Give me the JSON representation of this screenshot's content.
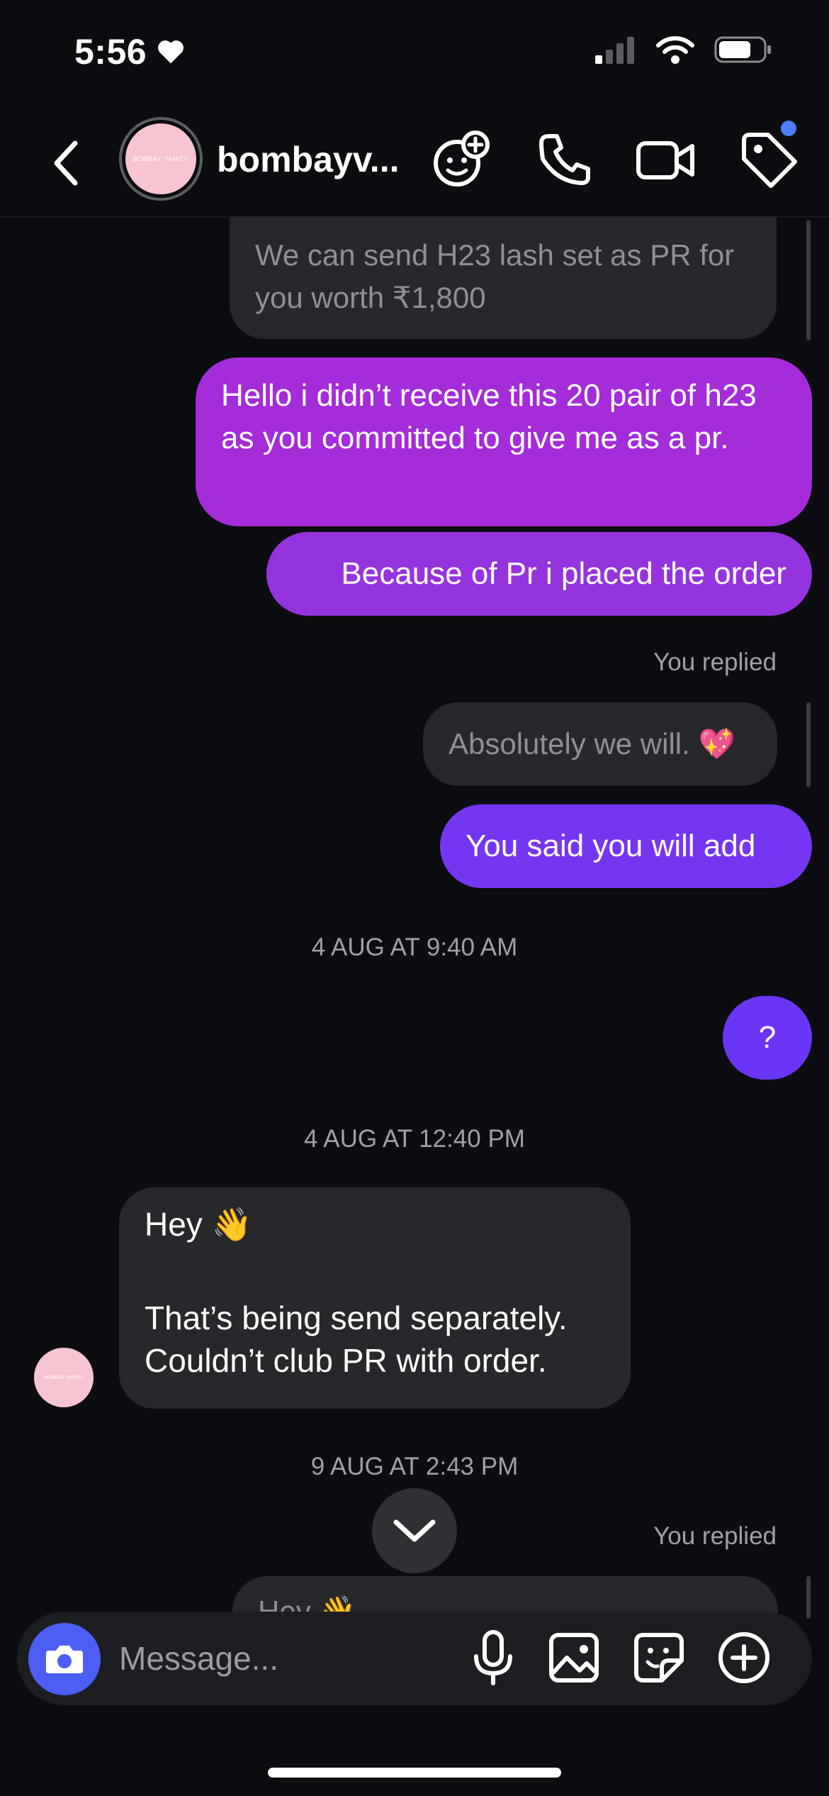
{
  "status_bar": {
    "time": "5:56"
  },
  "header": {
    "contact_name": "bombayv...",
    "avatar_text": "BOMBAY VANITY"
  },
  "messages": {
    "m1": "We can send H23 lash set as PR for you worth ₹1,800",
    "m2": "Hello i didn’t receive this 20 pair of h23 as you committed to give me as a pr.",
    "m3": "Because of Pr i placed the order",
    "replied1": "You replied",
    "m4": "Absolutely we will. 💖",
    "m5": "You said you will add",
    "ts1": "4 AUG AT 9:40 AM",
    "m6": "?",
    "ts2": "4 AUG AT 12:40 PM",
    "m7_line1": "Hey 👋",
    "m7_line2": "That’s being send separately. Couldn’t club PR with order.",
    "ts3": "9 AUG AT 2:43 PM",
    "replied2": "You replied",
    "m8_partial": "Hey 👋"
  },
  "composer": {
    "placeholder": "Message..."
  },
  "colors": {
    "sent_top": "#a72bd9",
    "sent_bottom": "#6a35f5",
    "received": "#26282c",
    "accent": "#4d5ef5"
  }
}
